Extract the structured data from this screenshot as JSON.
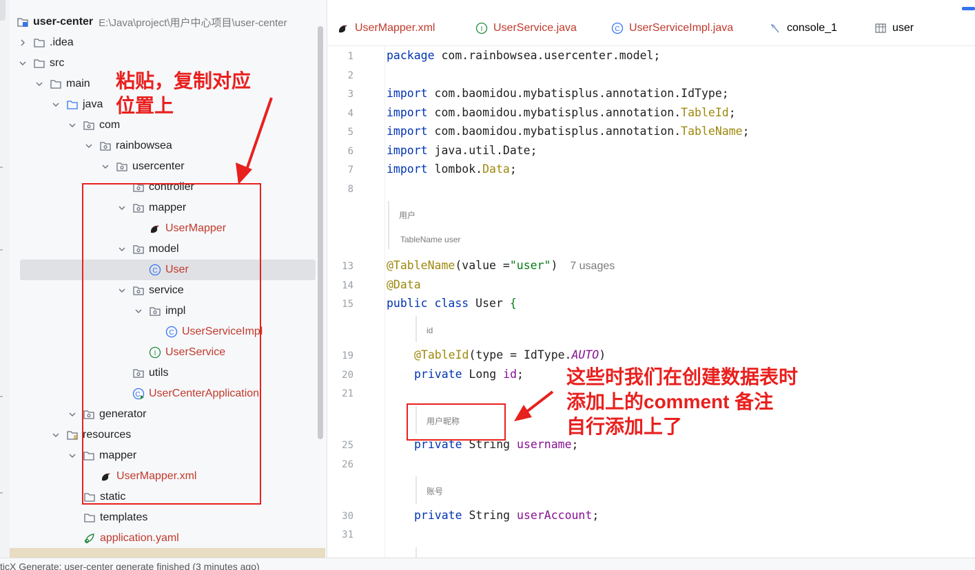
{
  "project": {
    "name": "user-center",
    "path": "E:\\Java\\project\\用户中心项目\\user-center"
  },
  "tree": {
    "idea": ".idea",
    "src": "src",
    "main": "main",
    "java": "java",
    "com": "com",
    "rainbowsea": "rainbowsea",
    "usercenter": "usercenter",
    "controller": "controller",
    "mapper": "mapper",
    "user_mapper": "UserMapper",
    "model": "model",
    "user": "User",
    "service": "service",
    "impl": "impl",
    "user_service_impl": "UserServiceImpl",
    "user_service": "UserService",
    "utils": "utils",
    "app": "UserCenterApplication",
    "generator": "generator",
    "resources": "resources",
    "res_mapper": "mapper",
    "user_mapper_xml": "UserMapper.xml",
    "static": "static",
    "templates": "templates",
    "application_yaml": "application.yaml"
  },
  "tabs": [
    {
      "label": "UserMapper.xml",
      "icon": "mybatis-bird-icon"
    },
    {
      "label": "UserService.java",
      "icon": "interface-icon"
    },
    {
      "label": "UserServiceImpl.java",
      "icon": "class-icon"
    },
    {
      "label": "console_1",
      "icon": "console-icon"
    },
    {
      "label": "user",
      "icon": "table-icon"
    }
  ],
  "editor": {
    "line_numbers": [
      "1",
      "2",
      "3",
      "4",
      "5",
      "6",
      "7",
      "8",
      "13",
      "14",
      "15",
      "19",
      "20",
      "21",
      "25",
      "26",
      "30",
      "31"
    ],
    "pkg_kw": "package",
    "pkg_name": "com.rainbowsea.usercenter.model;",
    "import_kw": "import",
    "imp1": "com.baomidou.mybatisplus.annotation.IdType;",
    "imp2_pre": "com.baomidou.mybatisplus.annotation.",
    "imp2_ann": "TableId",
    "imp3_pre": "com.baomidou.mybatisplus.annotation.",
    "imp3_ann": "TableName",
    "imp4": "java.util.Date;",
    "imp5_pre": "lombok.",
    "imp5_ann": "Data",
    "semi": ";",
    "doc_class_1": "用户",
    "doc_class_2": "TableName  user",
    "tn_ann": "@TableName",
    "tn_args_pre": "(value =",
    "tn_str": "\"user\"",
    "tn_args_post": ")",
    "usages": "7 usages",
    "data_ann": "@Data",
    "class_kw": "public class",
    "class_name": "User",
    "brace": "{",
    "doc_id": "id",
    "tid_ann": "@TableId",
    "tid_args_pre": "(type = IdType.",
    "tid_auto": "AUTO",
    "tid_args_post": ")",
    "private_kw": "private",
    "long_type": "Long",
    "id_field": "id",
    "doc_username": "用户昵称",
    "string_type": "String",
    "username_field": "username",
    "doc_account": "账号",
    "account_field": "userAccount"
  },
  "status": {
    "text": "ticX Generate: user-center generate finished (3 minutes ago)"
  },
  "annotations": {
    "note1_line1": "粘贴，复制对应",
    "note1_line2": "位置上",
    "note2_line1": "这些时我们在创建数据表时",
    "note2_line2": "添加上的comment 备注",
    "note2_line3": "自行添加上了"
  },
  "colors": {
    "keyword": "#0033b3",
    "annotation": "#9e880d",
    "string": "#067d17",
    "field": "#871094",
    "annotation_red": "#e8201e"
  }
}
